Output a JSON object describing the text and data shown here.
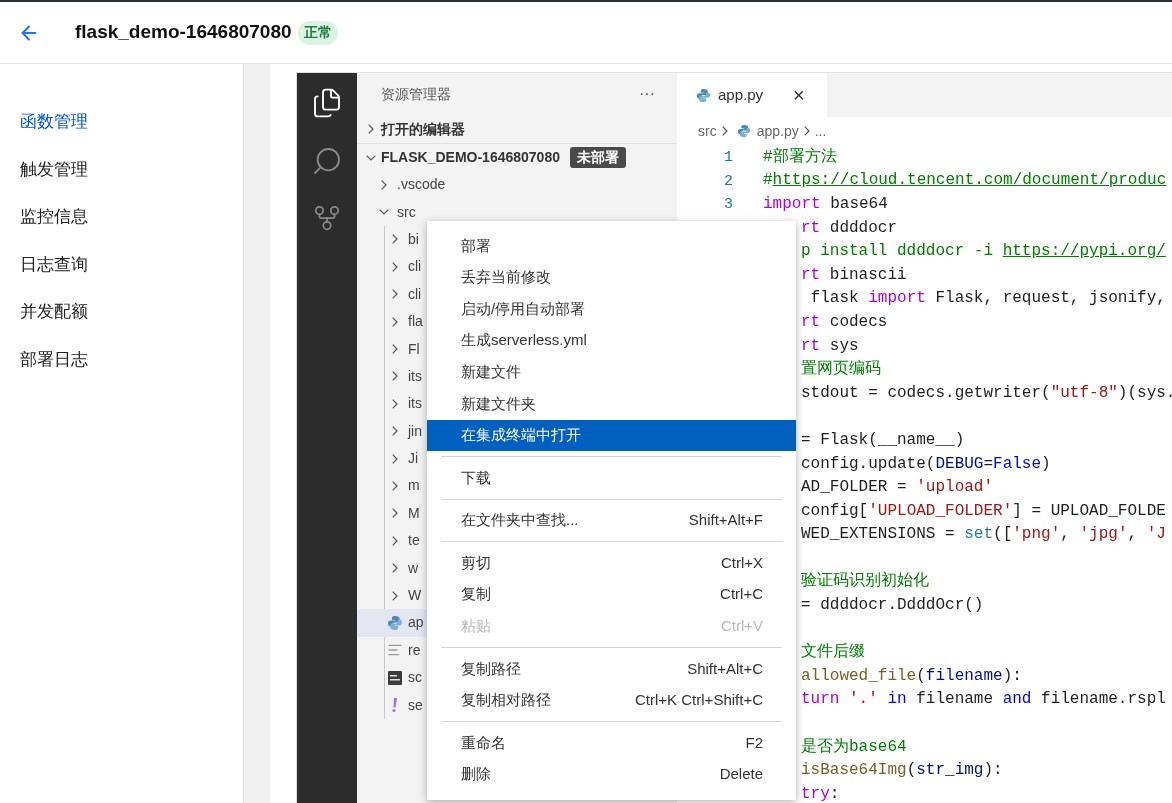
{
  "header": {
    "title": "flask_demo-1646807080",
    "status": "正常"
  },
  "nav": [
    {
      "label": "函数管理",
      "selected": true
    },
    {
      "label": "触发管理",
      "selected": false
    },
    {
      "label": "监控信息",
      "selected": false
    },
    {
      "label": "日志查询",
      "selected": false
    },
    {
      "label": "并发配额",
      "selected": false
    },
    {
      "label": "部署日志",
      "selected": false
    }
  ],
  "explorer": {
    "title": "资源管理器",
    "more": "···",
    "sections": [
      {
        "label": "打开的编辑器",
        "expanded": false
      }
    ],
    "root": {
      "label": "FLASK_DEMO-1646807080",
      "badge": "未部署",
      "expanded": true,
      "children": [
        {
          "label": ".vscode",
          "kind": "folder",
          "expanded": false,
          "selected": false
        },
        {
          "label": "src",
          "kind": "folder",
          "expanded": true,
          "selected": false,
          "children": [
            {
              "label": "bi",
              "kind": "folder",
              "expanded": false,
              "selected": false
            },
            {
              "label": "cli",
              "kind": "folder",
              "expanded": false,
              "selected": false
            },
            {
              "label": "cli",
              "kind": "folder",
              "expanded": false,
              "selected": false
            },
            {
              "label": "fla",
              "kind": "folder",
              "expanded": false,
              "selected": false
            },
            {
              "label": "Fl",
              "kind": "folder",
              "expanded": false,
              "selected": false
            },
            {
              "label": "its",
              "kind": "folder",
              "expanded": false,
              "selected": false
            },
            {
              "label": "its",
              "kind": "folder",
              "expanded": false,
              "selected": false
            },
            {
              "label": "jin",
              "kind": "folder",
              "expanded": false,
              "selected": false
            },
            {
              "label": "Ji",
              "kind": "folder",
              "expanded": false,
              "selected": false
            },
            {
              "label": "m",
              "kind": "folder",
              "expanded": false,
              "selected": false
            },
            {
              "label": "M",
              "kind": "folder",
              "expanded": false,
              "selected": false
            },
            {
              "label": "te",
              "kind": "folder",
              "expanded": false,
              "selected": false
            },
            {
              "label": "w",
              "kind": "folder",
              "expanded": false,
              "selected": false
            },
            {
              "label": "W",
              "kind": "folder",
              "expanded": false,
              "selected": false
            },
            {
              "label": "ap",
              "kind": "python",
              "selected": true
            },
            {
              "label": "re",
              "kind": "text",
              "selected": false
            },
            {
              "label": "sc",
              "kind": "script",
              "selected": false
            },
            {
              "label": "se",
              "kind": "yaml",
              "selected": false
            }
          ]
        }
      ]
    }
  },
  "editor": {
    "tabs": [
      {
        "label": "app.py",
        "selected": true,
        "close": "×"
      }
    ],
    "breadcrumb": [
      "src",
      "app.py",
      "..."
    ],
    "lines": [
      {
        "kind": "numbered",
        "number": "1",
        "segments": [
          {
            "text": "#部署方法",
            "kind": "comment"
          }
        ]
      },
      {
        "kind": "numbered",
        "number": "2",
        "segments": [
          {
            "text": "#",
            "kind": "comment"
          },
          {
            "text": "https://cloud.tencent.com/document/produc",
            "kind": "link"
          }
        ]
      },
      {
        "kind": "numbered",
        "number": "3",
        "segments": [
          {
            "text": "import",
            "kind": "keyword"
          },
          {
            "text": " base64",
            "kind": "plain"
          }
        ]
      },
      {
        "kind": "covered",
        "segments": [
          {
            "text": "rt",
            "kind": "keyword"
          },
          {
            "text": " ddddocr",
            "kind": "plain"
          }
        ]
      },
      {
        "kind": "covered",
        "segments": [
          {
            "text": "p install ddddocr -i ",
            "kind": "comment"
          },
          {
            "text": "https://pypi.org/",
            "kind": "link"
          }
        ]
      },
      {
        "kind": "covered",
        "segments": [
          {
            "text": "rt",
            "kind": "keyword"
          },
          {
            "text": " binascii",
            "kind": "plain"
          }
        ]
      },
      {
        "kind": "covered",
        "segments": [
          {
            "text": " flask ",
            "kind": "plain"
          },
          {
            "text": "import",
            "kind": "keyword"
          },
          {
            "text": " Flask, request, jsonify,",
            "kind": "plain"
          }
        ]
      },
      {
        "kind": "covered",
        "segments": [
          {
            "text": "rt",
            "kind": "keyword"
          },
          {
            "text": " codecs",
            "kind": "plain"
          }
        ]
      },
      {
        "kind": "covered",
        "segments": [
          {
            "text": "rt",
            "kind": "keyword"
          },
          {
            "text": " sys",
            "kind": "plain"
          }
        ]
      },
      {
        "kind": "covered",
        "segments": [
          {
            "text": "置网页编码",
            "kind": "comment"
          }
        ]
      },
      {
        "kind": "covered",
        "segments": [
          {
            "text": "stdout = codecs.getwriter(",
            "kind": "plain"
          },
          {
            "text": "\"utf-8\"",
            "kind": "string"
          },
          {
            "text": ")(sys.",
            "kind": "plain"
          }
        ]
      },
      {
        "kind": "blank"
      },
      {
        "kind": "covered",
        "segments": [
          {
            "text": "= Flask(__name__)",
            "kind": "plain"
          }
        ]
      },
      {
        "kind": "covered",
        "segments": [
          {
            "text": "config.update(",
            "kind": "plain"
          },
          {
            "text": "DEBUG",
            "kind": "variable"
          },
          {
            "text": "=",
            "kind": "plain"
          },
          {
            "text": "False",
            "kind": "constant"
          },
          {
            "text": ")",
            "kind": "plain"
          }
        ]
      },
      {
        "kind": "covered",
        "segments": [
          {
            "text": "AD_FOLDER = ",
            "kind": "plain"
          },
          {
            "text": "'upload'",
            "kind": "string"
          }
        ]
      },
      {
        "kind": "covered",
        "segments": [
          {
            "text": "config[",
            "kind": "plain"
          },
          {
            "text": "'UPLOAD_FOLDER'",
            "kind": "string"
          },
          {
            "text": "] = UPLOAD_FOLDE",
            "kind": "plain"
          }
        ]
      },
      {
        "kind": "covered",
        "segments": [
          {
            "text": "WED_EXTENSIONS = ",
            "kind": "plain"
          },
          {
            "text": "set",
            "kind": "builtin"
          },
          {
            "text": "([",
            "kind": "plain"
          },
          {
            "text": "'png'",
            "kind": "string"
          },
          {
            "text": ", ",
            "kind": "plain"
          },
          {
            "text": "'jpg'",
            "kind": "string"
          },
          {
            "text": ", ",
            "kind": "plain"
          },
          {
            "text": "'J",
            "kind": "string"
          }
        ]
      },
      {
        "kind": "blank"
      },
      {
        "kind": "covered",
        "segments": [
          {
            "text": "验证码识别初始化",
            "kind": "comment"
          }
        ]
      },
      {
        "kind": "covered",
        "segments": [
          {
            "text": "= ddddocr.DdddOcr()",
            "kind": "plain"
          }
        ]
      },
      {
        "kind": "blank"
      },
      {
        "kind": "covered",
        "segments": [
          {
            "text": "文件后缀",
            "kind": "comment"
          }
        ]
      },
      {
        "kind": "covered",
        "segments": [
          {
            "text": "allowed_file",
            "kind": "function"
          },
          {
            "text": "(",
            "kind": "plain"
          },
          {
            "text": "filename",
            "kind": "variable"
          },
          {
            "text": "):",
            "kind": "plain"
          }
        ]
      },
      {
        "kind": "covered",
        "segments": [
          {
            "text": "turn",
            "kind": "keyword"
          },
          {
            "text": " '.' ",
            "kind": "string"
          },
          {
            "text": "in",
            "kind": "constant"
          },
          {
            "text": " filename ",
            "kind": "plain"
          },
          {
            "text": "and",
            "kind": "constant"
          },
          {
            "text": " filename.rspl",
            "kind": "plain"
          }
        ]
      },
      {
        "kind": "blank"
      },
      {
        "kind": "covered",
        "segments": [
          {
            "text": "是否为base64",
            "kind": "comment"
          }
        ]
      },
      {
        "kind": "covered",
        "segments": [
          {
            "text": "isBase64Img",
            "kind": "function"
          },
          {
            "text": "(",
            "kind": "plain"
          },
          {
            "text": "str_img",
            "kind": "variable"
          },
          {
            "text": "):",
            "kind": "plain"
          }
        ]
      },
      {
        "kind": "covered",
        "segments": [
          {
            "text": "try",
            "kind": "keyword"
          },
          {
            "text": ":",
            "kind": "plain"
          }
        ]
      }
    ]
  },
  "context_menu": [
    {
      "kind": "item",
      "label": "部署",
      "disabled": false,
      "selected": false
    },
    {
      "kind": "item",
      "label": "丢弃当前修改",
      "disabled": false,
      "selected": false
    },
    {
      "kind": "item",
      "label": "启动/停用自动部署",
      "disabled": false,
      "selected": false
    },
    {
      "kind": "item",
      "label": "生成serverless.yml",
      "disabled": false,
      "selected": false
    },
    {
      "kind": "item",
      "label": "新建文件",
      "disabled": false,
      "selected": false
    },
    {
      "kind": "item",
      "label": "新建文件夹",
      "disabled": false,
      "selected": false
    },
    {
      "kind": "item",
      "label": "在集成终端中打开",
      "disabled": false,
      "selected": true
    },
    {
      "kind": "separator"
    },
    {
      "kind": "item",
      "label": "下载",
      "disabled": false,
      "selected": false
    },
    {
      "kind": "separator"
    },
    {
      "kind": "item",
      "label": "在文件夹中查找...",
      "shortcut": "Shift+Alt+F",
      "disabled": false,
      "selected": false
    },
    {
      "kind": "separator"
    },
    {
      "kind": "item",
      "label": "剪切",
      "shortcut": "Ctrl+X",
      "disabled": false,
      "selected": false
    },
    {
      "kind": "item",
      "label": "复制",
      "shortcut": "Ctrl+C",
      "disabled": false,
      "selected": false
    },
    {
      "kind": "item",
      "label": "粘贴",
      "shortcut": "Ctrl+V",
      "disabled": true,
      "selected": false
    },
    {
      "kind": "separator"
    },
    {
      "kind": "item",
      "label": "复制路径",
      "shortcut": "Shift+Alt+C",
      "disabled": false,
      "selected": false
    },
    {
      "kind": "item",
      "label": "复制相对路径",
      "shortcut": "Ctrl+K Ctrl+Shift+C",
      "disabled": false,
      "selected": false
    },
    {
      "kind": "separator"
    },
    {
      "kind": "item",
      "label": "重命名",
      "shortcut": "F2",
      "disabled": false,
      "selected": false
    },
    {
      "kind": "item",
      "label": "删除",
      "shortcut": "Delete",
      "disabled": false,
      "selected": false
    }
  ]
}
